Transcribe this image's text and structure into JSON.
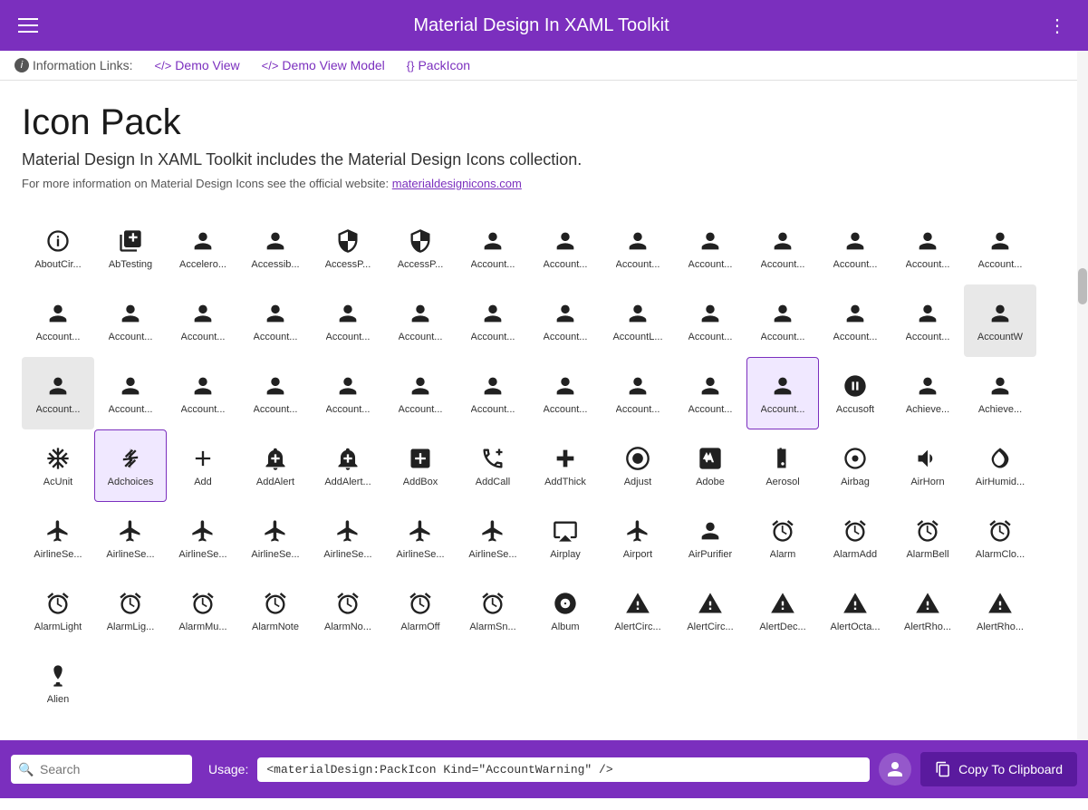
{
  "header": {
    "title": "Material Design In XAML Toolkit",
    "menu_icon": "≡",
    "more_icon": "⋮"
  },
  "info_bar": {
    "label": "Information Links:",
    "links": [
      {
        "icon": "</>",
        "text": "Demo View"
      },
      {
        "icon": "</>",
        "text": "Demo View Model"
      },
      {
        "icon": "{}",
        "text": "PackIcon"
      }
    ]
  },
  "page": {
    "title": "Icon Pack",
    "subtitle": "Material Design In XAML Toolkit includes the Material Design Icons collection.",
    "desc": "For more information on Material Design Icons see the official website:",
    "link_text": "materialdesignicons.com",
    "link_url": "#"
  },
  "bottom_bar": {
    "search_placeholder": "Search",
    "usage_label": "Usage:",
    "usage_code": "<materialDesign:PackIcon Kind=\"AccountWarning\" />",
    "copy_button": "Copy To Clipboard"
  },
  "icons": [
    {
      "id": "AboutCir",
      "label": "AboutCir..."
    },
    {
      "id": "AbTesting",
      "label": "AbTesting"
    },
    {
      "id": "Accelero",
      "label": "Accelero..."
    },
    {
      "id": "Accessib",
      "label": "Accessib..."
    },
    {
      "id": "AccessP1",
      "label": "AccessP..."
    },
    {
      "id": "AccessP2",
      "label": "AccessP..."
    },
    {
      "id": "Account1",
      "label": "Account..."
    },
    {
      "id": "Account2",
      "label": "Account..."
    },
    {
      "id": "Account3",
      "label": "Account..."
    },
    {
      "id": "Account4",
      "label": "Account..."
    },
    {
      "id": "Account5",
      "label": "Account..."
    },
    {
      "id": "Account6",
      "label": "Account..."
    },
    {
      "id": "Account7",
      "label": "Account..."
    },
    {
      "id": "Account8",
      "label": "Account..."
    },
    {
      "id": "Account9",
      "label": "Account..."
    },
    {
      "id": "Account10",
      "label": "Account..."
    },
    {
      "id": "Account11",
      "label": "Account..."
    },
    {
      "id": "Account12",
      "label": "Account..."
    },
    {
      "id": "Account13",
      "label": "Account..."
    },
    {
      "id": "Account14",
      "label": "Account..."
    },
    {
      "id": "Account15",
      "label": "Account..."
    },
    {
      "id": "Account16",
      "label": "Account..."
    },
    {
      "id": "AccountL",
      "label": "AccountL..."
    },
    {
      "id": "Account17",
      "label": "Account..."
    },
    {
      "id": "Account18",
      "label": "Account..."
    },
    {
      "id": "Account19",
      "label": "Account..."
    },
    {
      "id": "Account20",
      "label": "Account..."
    },
    {
      "id": "Account21",
      "label": "AccountW",
      "selected": true
    },
    {
      "id": "Account22",
      "label": "Account...",
      "selected": true
    },
    {
      "id": "Account23",
      "label": "Account..."
    },
    {
      "id": "Account24",
      "label": "Account..."
    },
    {
      "id": "Account25",
      "label": "Account..."
    },
    {
      "id": "Account26",
      "label": "Account..."
    },
    {
      "id": "Account27",
      "label": "Account..."
    },
    {
      "id": "Account28",
      "label": "Account..."
    },
    {
      "id": "Account29",
      "label": "Account..."
    },
    {
      "id": "Account30",
      "label": "Account..."
    },
    {
      "id": "Account31",
      "label": "Account..."
    },
    {
      "id": "Account32",
      "label": "Account...",
      "selected_last": true
    },
    {
      "id": "Accusoft",
      "label": "Accusoft"
    },
    {
      "id": "Achieve1",
      "label": "Achieve..."
    },
    {
      "id": "Achieve2",
      "label": "Achieve..."
    },
    {
      "id": "AcUnit",
      "label": "AcUnit"
    },
    {
      "id": "Adchoices",
      "label": "Adchoices",
      "selected_last": true
    },
    {
      "id": "Add",
      "label": "Add"
    },
    {
      "id": "AddAlert",
      "label": "AddAlert"
    },
    {
      "id": "AddAlert2",
      "label": "AddAlert..."
    },
    {
      "id": "AddBox",
      "label": "AddBox"
    },
    {
      "id": "AddCall",
      "label": "AddCall"
    },
    {
      "id": "AddThick",
      "label": "AddThick"
    },
    {
      "id": "Adjust",
      "label": "Adjust"
    },
    {
      "id": "Adobe",
      "label": "Adobe"
    },
    {
      "id": "Aerosol",
      "label": "Aerosol"
    },
    {
      "id": "Airbag",
      "label": "Airbag"
    },
    {
      "id": "AirHorn",
      "label": "AirHorn"
    },
    {
      "id": "AirHumid",
      "label": "AirHumid..."
    },
    {
      "id": "AirlineSe1",
      "label": "AirlineSe..."
    },
    {
      "id": "AirlineSe2",
      "label": "AirlineSe..."
    },
    {
      "id": "AirlineSe3",
      "label": "AirlineSe..."
    },
    {
      "id": "AirlineSe4",
      "label": "AirlineSe..."
    },
    {
      "id": "AirlineSe5",
      "label": "AirlineSe..."
    },
    {
      "id": "AirlineSe6",
      "label": "AirlineSe..."
    },
    {
      "id": "AirlineSe7",
      "label": "AirlineSe..."
    },
    {
      "id": "Airplay",
      "label": "Airplay"
    },
    {
      "id": "Airport",
      "label": "Airport"
    },
    {
      "id": "AirPurifier",
      "label": "AirPurifier"
    },
    {
      "id": "Alarm",
      "label": "Alarm"
    },
    {
      "id": "AlarmAdd",
      "label": "AlarmAdd"
    },
    {
      "id": "AlarmBell",
      "label": "AlarmBell"
    },
    {
      "id": "AlarmClo",
      "label": "AlarmClo..."
    },
    {
      "id": "AlarmLight",
      "label": "AlarmLight"
    },
    {
      "id": "AlarmLig2",
      "label": "AlarmLig..."
    },
    {
      "id": "AlarmMu",
      "label": "AlarmMu..."
    },
    {
      "id": "AlarmNote",
      "label": "AlarmNote"
    },
    {
      "id": "AlarmNo2",
      "label": "AlarmNo..."
    },
    {
      "id": "AlarmOff",
      "label": "AlarmOff"
    },
    {
      "id": "AlarmSn",
      "label": "AlarmSn..."
    },
    {
      "id": "Album",
      "label": "Album"
    },
    {
      "id": "AlertCirc1",
      "label": "AlertCirc..."
    },
    {
      "id": "AlertCirc2",
      "label": "AlertCirc..."
    },
    {
      "id": "AlertDec",
      "label": "AlertDec..."
    },
    {
      "id": "AlertOcta",
      "label": "AlertOcta..."
    },
    {
      "id": "AlertRho1",
      "label": "AlertRho..."
    },
    {
      "id": "AlertRho2",
      "label": "AlertRho..."
    },
    {
      "id": "Alien",
      "label": "Alien"
    }
  ]
}
